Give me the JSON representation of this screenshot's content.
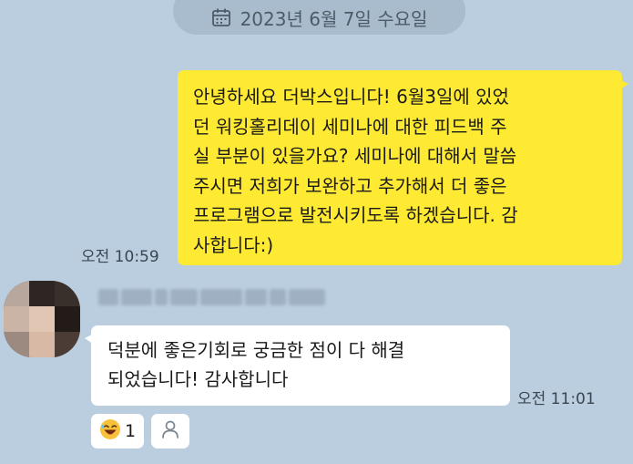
{
  "date_divider": {
    "icon": "calendar-icon",
    "text": "2023년 6월 7일 수요일"
  },
  "messages": [
    {
      "direction": "outgoing",
      "text": "안녕하세요 더박스입니다! 6월3일에 있었\n던 워킹홀리데이 세미나에 대한 피드백 주\n실 부분이 있을가요? 세미나에 대해서 말씀\n주시면 저희가 보완하고 추가해서 더 좋은\n프로그램으로 발전시키도록 하겠습니다. 감\n사합니다:)",
      "time": "오전 10:59"
    },
    {
      "direction": "incoming",
      "text": "덕분에 좋은기회로 궁금한 점이 다 해결\n되었습니다! 감사합니다",
      "time": "오전 11:01",
      "reaction": {
        "icon": "laughing-face-emoji",
        "count": "1"
      },
      "add_reaction_icon": "person-icon"
    }
  ],
  "colors": {
    "background": "#bacee0",
    "outgoing_bubble": "#fee933",
    "incoming_bubble": "#ffffff"
  }
}
